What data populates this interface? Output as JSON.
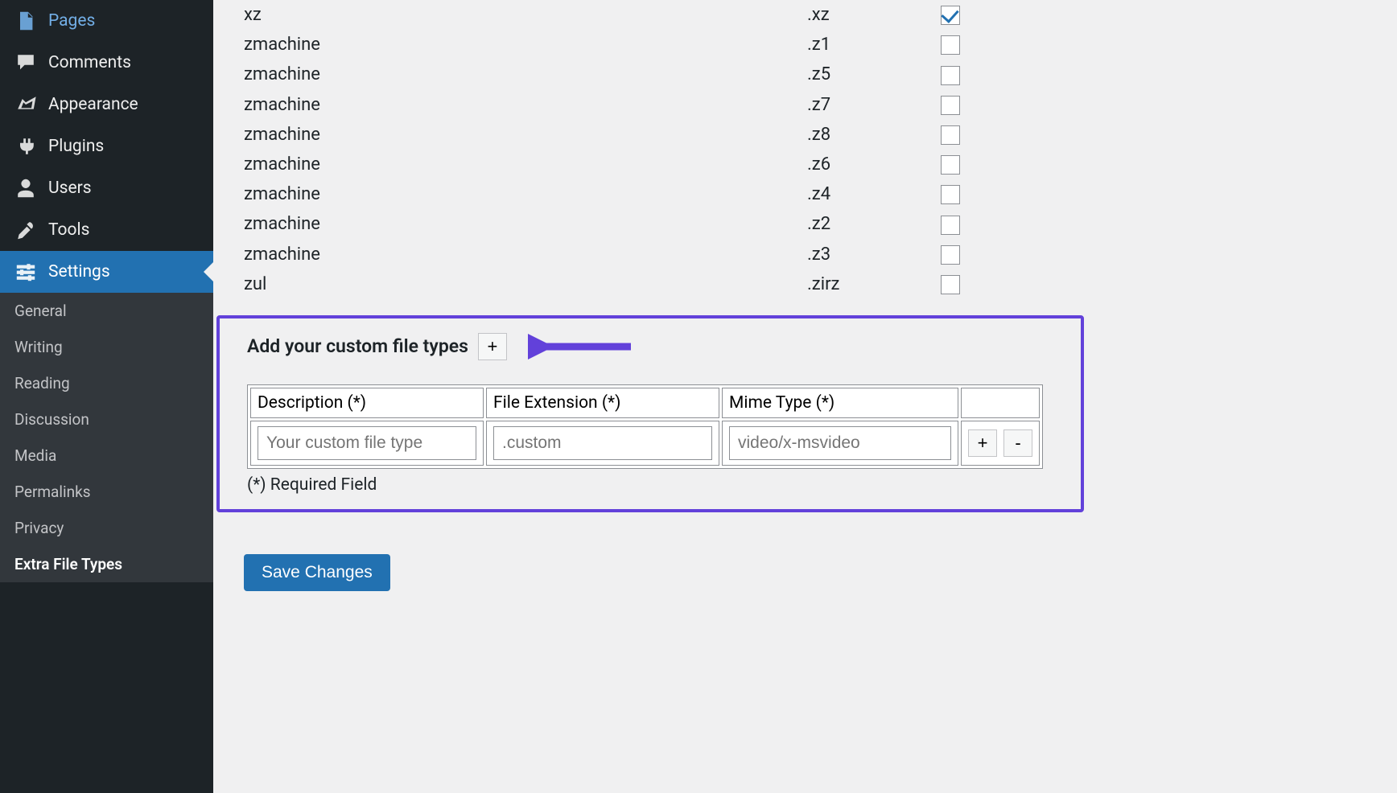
{
  "sidebar": {
    "main_items": [
      {
        "label": "Pages",
        "icon": "pages"
      },
      {
        "label": "Comments",
        "icon": "comments"
      },
      {
        "label": "Appearance",
        "icon": "appearance"
      },
      {
        "label": "Plugins",
        "icon": "plugins"
      },
      {
        "label": "Users",
        "icon": "users"
      },
      {
        "label": "Tools",
        "icon": "tools"
      },
      {
        "label": "Settings",
        "icon": "settings",
        "active": true
      }
    ],
    "sub_items": [
      {
        "label": "General"
      },
      {
        "label": "Writing"
      },
      {
        "label": "Reading"
      },
      {
        "label": "Discussion"
      },
      {
        "label": "Media"
      },
      {
        "label": "Permalinks"
      },
      {
        "label": "Privacy"
      },
      {
        "label": "Extra File Types",
        "current": true
      }
    ]
  },
  "file_types": [
    {
      "name": "xz",
      "ext": ".xz",
      "checked": true
    },
    {
      "name": "zmachine",
      "ext": ".z1",
      "checked": false
    },
    {
      "name": "zmachine",
      "ext": ".z5",
      "checked": false
    },
    {
      "name": "zmachine",
      "ext": ".z7",
      "checked": false
    },
    {
      "name": "zmachine",
      "ext": ".z8",
      "checked": false
    },
    {
      "name": "zmachine",
      "ext": ".z6",
      "checked": false
    },
    {
      "name": "zmachine",
      "ext": ".z4",
      "checked": false
    },
    {
      "name": "zmachine",
      "ext": ".z2",
      "checked": false
    },
    {
      "name": "zmachine",
      "ext": ".z3",
      "checked": false
    },
    {
      "name": "zul",
      "ext": ".zirz",
      "checked": false
    }
  ],
  "custom": {
    "section_title": "Add your custom file types",
    "add_btn": "+",
    "headers": {
      "desc": "Description (*)",
      "ext": "File Extension (*)",
      "mime": "Mime Type (*)"
    },
    "placeholders": {
      "desc": "Your custom file type",
      "ext": ".custom",
      "mime": "video/x-msvideo"
    },
    "add_row_btn": "+",
    "remove_row_btn": "-",
    "required_note": "(*) Required Field"
  },
  "save_btn": "Save Changes"
}
